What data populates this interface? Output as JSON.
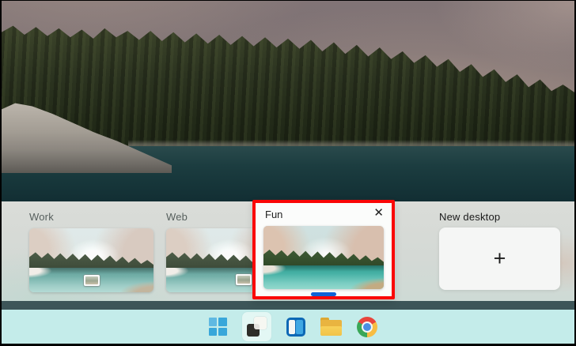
{
  "task_view": {
    "desktops": [
      {
        "name": "Work",
        "state": "normal",
        "has_open_window": true
      },
      {
        "name": "Web",
        "state": "normal",
        "has_open_window": true
      },
      {
        "name": "Fun",
        "state": "active",
        "close_glyph": "✕"
      }
    ],
    "new_desktop_label": "New desktop",
    "plus_glyph": "+",
    "active_indicator_color": "#0f62d7"
  },
  "annotation": {
    "type": "rectangle",
    "color": "#fa0606",
    "highlights": "Fun desktop card"
  },
  "taskbar": {
    "background": "#c4ecea",
    "icons": [
      {
        "name": "start",
        "icon": "windows-logo"
      },
      {
        "name": "task-view",
        "icon": "overlapping-windows",
        "active": true
      },
      {
        "name": "widgets",
        "icon": "widgets-panel"
      },
      {
        "name": "file-explorer",
        "icon": "folder"
      },
      {
        "name": "chrome",
        "icon": "chrome-circle"
      }
    ]
  },
  "colors": {
    "annotation_red": "#fa0606",
    "accent_blue": "#0f62d7",
    "panel_bg": "#d6dad6",
    "taskbar_bg": "#c4ecea",
    "strip_dark": "#3d5558"
  }
}
